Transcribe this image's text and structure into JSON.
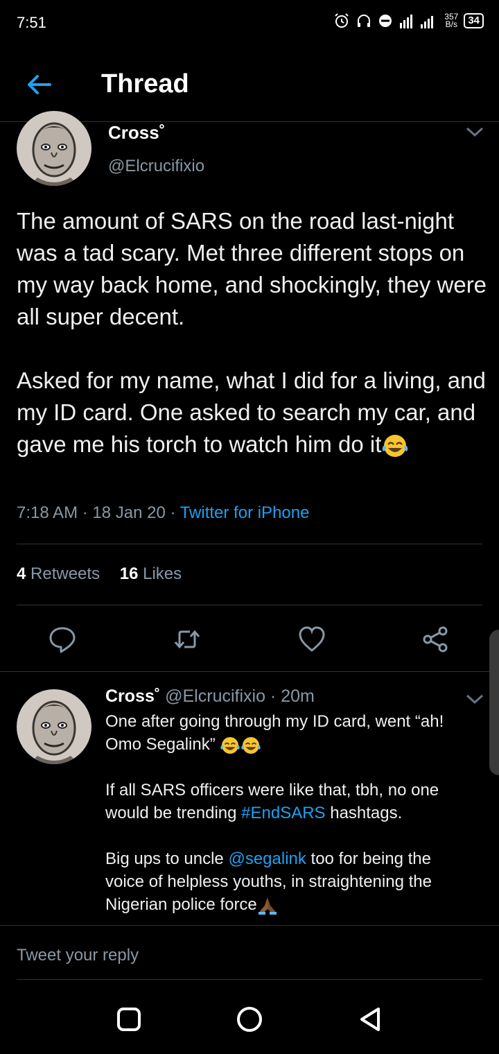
{
  "status_bar": {
    "time": "7:51",
    "network_speed_value": "357",
    "network_speed_unit": "B/s",
    "battery": "34"
  },
  "header": {
    "title": "Thread"
  },
  "main_tweet": {
    "name": "Cross˚",
    "handle": "@Elcrucifixio",
    "paragraph_1": "The amount of SARS on the road last-night was a tad scary. Met three different stops on my way back home, and shockingly, they were all super decent.",
    "paragraph_2": "Asked for my name, what I did for a living, and my ID card. One asked to search my car, and gave me his torch to watch him do it",
    "time": "7:18 AM · 18 Jan 20 · ",
    "source": "Twitter for iPhone",
    "retweets_count": "4",
    "retweets_label": " Retweets",
    "likes_count": "16",
    "likes_label": " Likes"
  },
  "reply_tweet": {
    "name": "Cross˚",
    "handle_time": " @Elcrucifixio · 20m",
    "paragraph_1": "One after going through my ID card, went “ah! Omo Segalink”",
    "paragraph_2_before": "If all SARS officers were like that, tbh, no one would be trending ",
    "hashtag": "#EndSARS",
    "paragraph_2_after": " hashtags.",
    "paragraph_3_before": "Big ups to uncle ",
    "mention": "@segalink",
    "paragraph_3_after": " too for being the voice of helpless youths, in straightening the Nigerian police force"
  },
  "reply_box": {
    "placeholder": "Tweet your reply"
  },
  "icons": {
    "alarm": "alarm-icon",
    "headset": "headset-icon",
    "dnd": "do-not-disturb-icon",
    "signal": "signal-icon",
    "back": "back-arrow-icon",
    "chevron": "chevron-down-icon",
    "reply": "reply-icon",
    "retweet": "retweet-icon",
    "like": "heart-icon",
    "share": "share-icon",
    "laugh_emoji": "face-with-tears-of-joy-emoji",
    "pray_emoji": "folded-hands-emoji"
  },
  "colors": {
    "background": "#000000",
    "accent": "#1da1f2",
    "secondary_text": "#8899a6",
    "divider": "#2f3336"
  }
}
